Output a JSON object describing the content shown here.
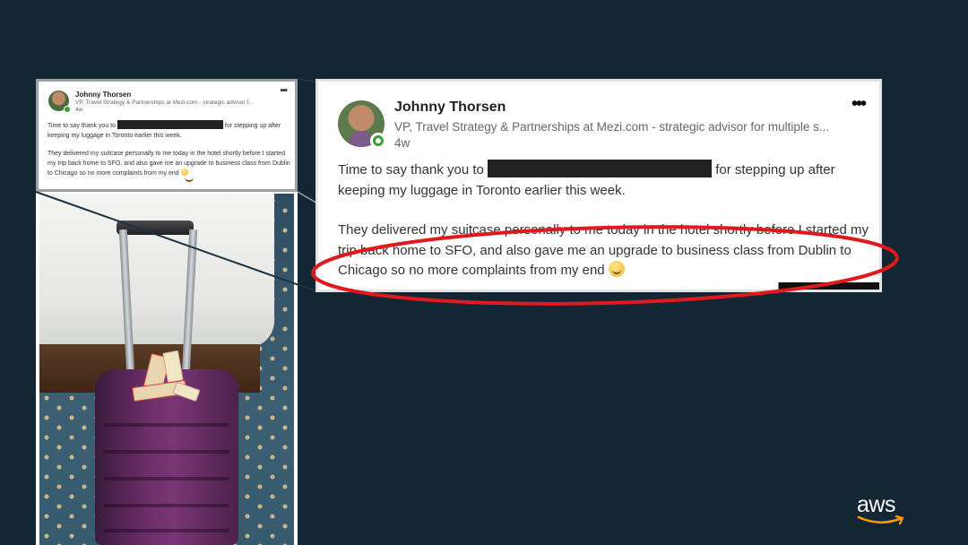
{
  "post": {
    "author_name": "Johnny Thorsen",
    "author_headline": "VP, Travel Strategy & Partnerships at Mezi.com - strategic advisor for multiple s...",
    "author_headline_small": "VP, Travel Strategy & Partnerships at Mezi.com - strategic advisor f...",
    "time_ago": "4w",
    "more_menu": "•••",
    "line1_before": "Time to say thank you to ",
    "line1_after": " for stepping up after keeping my luggage in Toronto earlier this week.",
    "paragraph2": "They delivered my suitcase personally to me today in the hotel shortly before I started my trip back home to SFO, and also gave me an upgrade to business class from Dublin to Chicago so no more complaints from my end"
  },
  "branding": {
    "logo_text": "aws",
    "logo_color": "#ff9900"
  },
  "colors": {
    "background": "#132634",
    "highlight": "#e0191f"
  }
}
